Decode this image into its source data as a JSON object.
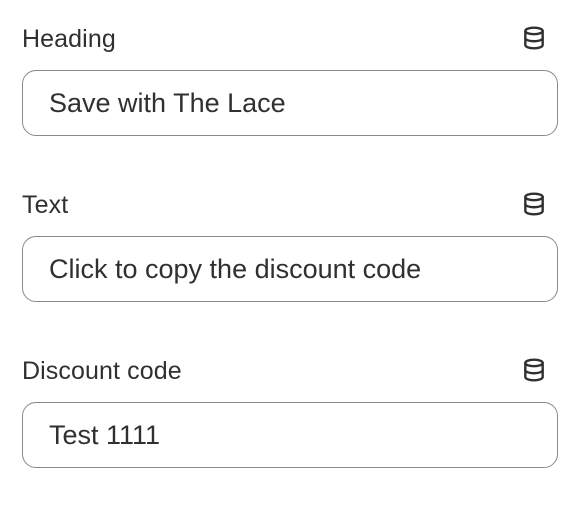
{
  "fields": [
    {
      "label": "Heading",
      "value": "Save with The Lace",
      "icon": "database-icon"
    },
    {
      "label": "Text",
      "value": "Click to copy the discount code",
      "icon": "database-icon"
    },
    {
      "label": "Discount code",
      "value": "Test 1111",
      "icon": "database-icon"
    }
  ],
  "colors": {
    "text": "#303030",
    "border": "#8a8a8a",
    "background": "#ffffff"
  }
}
